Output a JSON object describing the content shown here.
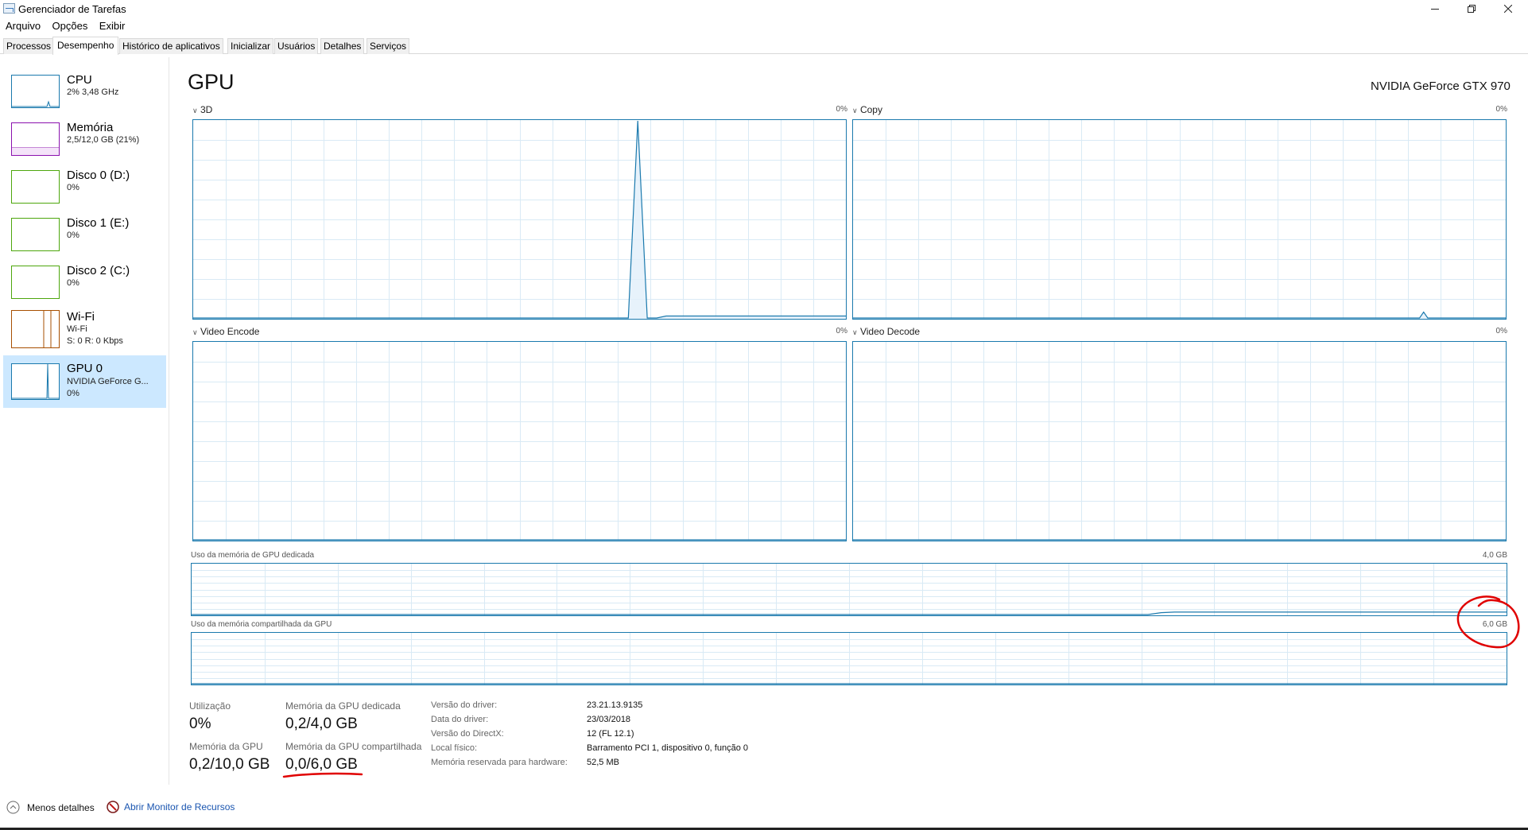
{
  "window": {
    "title": "Gerenciador de Tarefas",
    "minimize_icon": "minimize-icon",
    "restore_icon": "restore-icon",
    "close_icon": "close-icon"
  },
  "menu": [
    "Arquivo",
    "Opções",
    "Exibir"
  ],
  "tabs": [
    "Processos",
    "Desempenho",
    "Histórico de aplicativos",
    "Inicializar",
    "Usuários",
    "Detalhes",
    "Serviços"
  ],
  "active_tab": "Desempenho",
  "sidebar": [
    {
      "title": "CPU",
      "sub1": "2% 3,48 GHz",
      "color": "#1a79ad"
    },
    {
      "title": "Memória",
      "sub1": "2,5/12,0 GB (21%)",
      "color": "#8b12ae"
    },
    {
      "title": "Disco 0 (D:)",
      "sub1": "0%",
      "color": "#4da60c"
    },
    {
      "title": "Disco 1 (E:)",
      "sub1": "0%",
      "color": "#4da60c"
    },
    {
      "title": "Disco 2 (C:)",
      "sub1": "0%",
      "color": "#4da60c"
    },
    {
      "title": "Wi-Fi",
      "sub1": "Wi-Fi",
      "sub2": "S: 0 R: 0 Kbps",
      "color": "#a74f01"
    },
    {
      "title": "GPU 0",
      "sub1": "NVIDIA GeForce G...",
      "sub2": "0%",
      "color": "#1a79ad",
      "selected": true
    }
  ],
  "main": {
    "title": "GPU",
    "gpu_name": "NVIDIA GeForce GTX 970",
    "engines": [
      {
        "name": "3D",
        "pct": "0%"
      },
      {
        "name": "Copy",
        "pct": "0%"
      },
      {
        "name": "Video Encode",
        "pct": "0%"
      },
      {
        "name": "Video Decode",
        "pct": "0%"
      }
    ],
    "dedicated_label": "Uso da memória de GPU dedicada",
    "dedicated_max": "4,0 GB",
    "shared_label": "Uso da memória compartilhada da GPU",
    "shared_max": "6,0 GB"
  },
  "stats": {
    "util_label": "Utilização",
    "util_value": "0%",
    "dedicated_label": "Memória da GPU dedicada",
    "dedicated_value": "0,2/4,0 GB",
    "gpu_mem_label": "Memória da GPU",
    "gpu_mem_value": "0,2/10,0 GB",
    "shared_label": "Memória da GPU compartilhada",
    "shared_value": "0,0/6,0 GB"
  },
  "info": [
    {
      "label": "Versão do driver:",
      "value": "23.21.13.9135"
    },
    {
      "label": "Data do driver:",
      "value": "23/03/2018"
    },
    {
      "label": "Versão do DirectX:",
      "value": "12 (FL 12.1)"
    },
    {
      "label": "Local físico:",
      "value": "Barramento PCI 1, dispositivo 0, função 0"
    },
    {
      "label": "Memória reservada para hardware:",
      "value": "52,5 MB"
    }
  ],
  "footer": {
    "less_details": "Menos detalhes",
    "resource_monitor": "Abrir Monitor de Recursos"
  },
  "annotation_color": "#e00000",
  "chart_data": [
    {
      "type": "area",
      "title": "3D",
      "ylim": [
        0,
        100
      ],
      "values": [
        0,
        0,
        0,
        0,
        0,
        0,
        0,
        0,
        0,
        0,
        0,
        0,
        0,
        0,
        0,
        0,
        0,
        0,
        0,
        0,
        0,
        0,
        0,
        0,
        0,
        0,
        0,
        0,
        0,
        0,
        0,
        0,
        0,
        0,
        0,
        0,
        0,
        0,
        0,
        0,
        0,
        0,
        0,
        0,
        0,
        0,
        0,
        100,
        0,
        0,
        1,
        1,
        1,
        1,
        1,
        1,
        1,
        1,
        1,
        1,
        1,
        1,
        1,
        1,
        1,
        1,
        1,
        1,
        1,
        1
      ]
    },
    {
      "type": "area",
      "title": "Copy",
      "ylim": [
        0,
        100
      ],
      "values": [
        0,
        0,
        0,
        0,
        0,
        0,
        0,
        0,
        0,
        0,
        0,
        0,
        0,
        0,
        0,
        0,
        0,
        0,
        0,
        0,
        0,
        0,
        0,
        0,
        0,
        0,
        0,
        0,
        0,
        0,
        0,
        0,
        0,
        0,
        0,
        0,
        0,
        0,
        0,
        0,
        0,
        0,
        0,
        0,
        0,
        0,
        0,
        0,
        0,
        0,
        0,
        0,
        0,
        0,
        0,
        0,
        0,
        0,
        0,
        0,
        0,
        0,
        0,
        0,
        0,
        0,
        0,
        0,
        0,
        0,
        0,
        0,
        0,
        0,
        0,
        0,
        0,
        0,
        0,
        0,
        0,
        0,
        0,
        0,
        0,
        0,
        0,
        0,
        0,
        0,
        0,
        0,
        0,
        0,
        0,
        0,
        0,
        0,
        0,
        0,
        0,
        0,
        0,
        0,
        0,
        0,
        0,
        0,
        0,
        0,
        0,
        0,
        0,
        0,
        0,
        0,
        0,
        0,
        0,
        0,
        0,
        0,
        0,
        0,
        0,
        0,
        0,
        0,
        0,
        0,
        0,
        0,
        0,
        0,
        0,
        0,
        0,
        0,
        0,
        3,
        0,
        0,
        0,
        0,
        0,
        0,
        0,
        0,
        0,
        0,
        0,
        0,
        0,
        0,
        0,
        0,
        0,
        0,
        0,
        0
      ]
    },
    {
      "type": "area",
      "title": "Video Encode",
      "ylim": [
        0,
        100
      ],
      "values": [
        0,
        0,
        0,
        0,
        0,
        0,
        0,
        0,
        0,
        0
      ]
    },
    {
      "type": "area",
      "title": "Video Decode",
      "ylim": [
        0,
        100
      ],
      "values": [
        0,
        0,
        0,
        0,
        0,
        0,
        0,
        0,
        0,
        0
      ]
    },
    {
      "type": "line",
      "title": "Uso da memória de GPU dedicada",
      "ylim": [
        0,
        4.0
      ],
      "values": [
        0,
        0,
        0,
        0,
        0,
        0,
        0,
        0,
        0,
        0,
        0,
        0,
        0,
        0,
        0,
        0,
        0,
        0,
        0,
        0,
        0,
        0,
        0,
        0,
        0,
        0,
        0,
        0,
        0,
        0,
        0,
        0,
        0,
        0,
        0,
        0,
        0,
        0,
        0,
        0,
        0,
        0,
        0,
        0,
        0,
        0,
        0,
        0,
        0,
        0,
        0,
        0,
        0,
        0,
        0,
        0,
        0,
        0,
        0,
        0,
        0,
        0,
        0,
        0,
        0,
        0,
        0,
        0,
        0,
        0,
        0,
        0,
        0,
        0.15,
        0.2,
        0.2,
        0.2,
        0.2,
        0.2,
        0.2,
        0.2,
        0.2,
        0.2,
        0.2,
        0.2,
        0.2,
        0.2,
        0.2,
        0.2,
        0.2,
        0.2,
        0.2,
        0.2,
        0.2,
        0.2,
        0.2,
        0.2,
        0.2,
        0.2,
        0.2
      ]
    },
    {
      "type": "line",
      "title": "Uso da memória compartilhada da GPU",
      "ylim": [
        0,
        6.0
      ],
      "values": [
        0,
        0,
        0,
        0,
        0,
        0,
        0,
        0,
        0,
        0
      ]
    }
  ]
}
